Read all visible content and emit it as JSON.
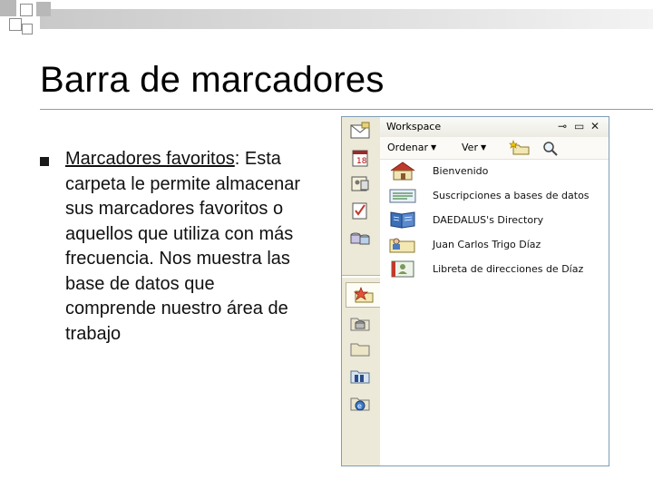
{
  "slide": {
    "title": "Barra de marcadores",
    "bullet": {
      "term": "Marcadores favoritos",
      "text": ": Esta carpeta le permite almacenar sus marcadores favoritos o aquellos que utiliza con más frecuencia. Nos muestra las base de datos que comprende nuestro área de trabajo"
    }
  },
  "workspace": {
    "title": "Workspace",
    "window_buttons": [
      "pin-icon",
      "minimize-icon",
      "close-icon"
    ],
    "toolbar": {
      "sort_label": "Ordenar",
      "view_label": "Ver",
      "icons": [
        "new-folder-icon",
        "search-icon"
      ]
    },
    "items": [
      {
        "label": "Bienvenido",
        "icon": "home-icon"
      },
      {
        "label": "Suscripciones a bases de datos",
        "icon": "subscription-icon"
      },
      {
        "label": "DAEDALUS's Directory",
        "icon": "book-icon"
      },
      {
        "label": "Juan Carlos Trigo Díaz",
        "icon": "user-folder-icon"
      },
      {
        "label": "Libreta de direcciones de Díaz",
        "icon": "address-book-icon"
      }
    ],
    "sidebar_icons": [
      "mail-icon",
      "calendar-icon",
      "contacts-icon",
      "tasks-icon",
      "databases-icon",
      "favorites-icon",
      "database-folder-icon",
      "folder-icon",
      "server-folder-icon",
      "web-folder-icon"
    ],
    "active_sidebar": "favorites-icon"
  }
}
